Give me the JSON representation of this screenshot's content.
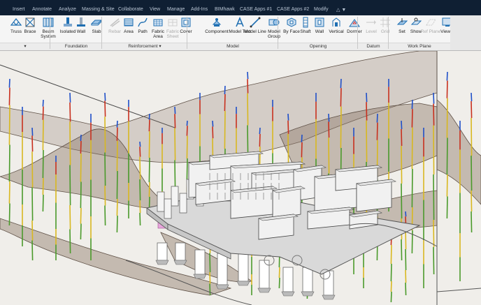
{
  "tabs": [
    {
      "label": "Insert"
    },
    {
      "label": "Annotate"
    },
    {
      "label": "Analyze"
    },
    {
      "label": "Massing & Site"
    },
    {
      "label": "Collaborate"
    },
    {
      "label": "View"
    },
    {
      "label": "Manage"
    },
    {
      "label": "Add-Ins"
    },
    {
      "label": "BIMhawk"
    },
    {
      "label": "CASE Apps #1"
    },
    {
      "label": "CASE Apps #2"
    },
    {
      "label": "Modify"
    }
  ],
  "tab_extra": "△ ▼",
  "tools": [
    {
      "label": "Truss",
      "icon": "truss-icon"
    },
    {
      "label": "Brace",
      "icon": "brace-icon"
    },
    {
      "label": "Beam System",
      "icon": "beam-system-icon"
    },
    {
      "label": "Isolated",
      "icon": "isolated-footing-icon"
    },
    {
      "label": "Wall",
      "icon": "wall-footing-icon"
    },
    {
      "label": "Slab",
      "icon": "slab-icon"
    },
    {
      "label": "Rebar",
      "icon": "rebar-icon",
      "disabled": true
    },
    {
      "label": "Area",
      "icon": "area-icon"
    },
    {
      "label": "Path",
      "icon": "path-icon"
    },
    {
      "label": "Fabric Area",
      "icon": "fabric-area-icon"
    },
    {
      "label": "Fabric Sheet",
      "icon": "fabric-sheet-icon",
      "disabled": true
    },
    {
      "label": "Cover",
      "icon": "cover-icon"
    },
    {
      "label": "Component",
      "icon": "component-icon"
    },
    {
      "label": "Model Text",
      "icon": "model-text-icon"
    },
    {
      "label": "Model Line",
      "icon": "model-line-icon"
    },
    {
      "label": "Model Group",
      "icon": "model-group-icon"
    },
    {
      "label": "By Face",
      "icon": "by-face-icon"
    },
    {
      "label": "Shaft",
      "icon": "shaft-icon"
    },
    {
      "label": "Wall",
      "icon": "wall-opening-icon"
    },
    {
      "label": "Vertical",
      "icon": "vertical-icon"
    },
    {
      "label": "Dormer",
      "icon": "dormer-icon"
    },
    {
      "label": "Level",
      "icon": "level-icon",
      "disabled": true
    },
    {
      "label": "Grid",
      "icon": "grid-icon",
      "disabled": true
    },
    {
      "label": "Set",
      "icon": "set-icon"
    },
    {
      "label": "Show",
      "icon": "show-icon"
    },
    {
      "label": "Ref Plane",
      "icon": "ref-plane-icon",
      "disabled": true
    },
    {
      "label": "Viewer",
      "icon": "viewer-icon"
    }
  ],
  "panels": [
    {
      "label": "▾"
    },
    {
      "label": "Foundation"
    },
    {
      "label": "Reinforcement ▾"
    },
    {
      "label": "Model"
    },
    {
      "label": "Opening"
    },
    {
      "label": "Datum"
    },
    {
      "label": "Work Plane"
    }
  ],
  "colors": {
    "tabbar": "#0f1f33",
    "ribbon": "#f5f5f5",
    "icon_blue": "#1f6fb2",
    "canvas": "#f0eeea",
    "terrain": "#8d7a6a",
    "bore_green": "#4a9a2a",
    "bore_yellow": "#d8b820",
    "bore_red": "#c8301e",
    "bore_blue": "#1f4fc8",
    "pile_pink": "#e8a6dc"
  }
}
